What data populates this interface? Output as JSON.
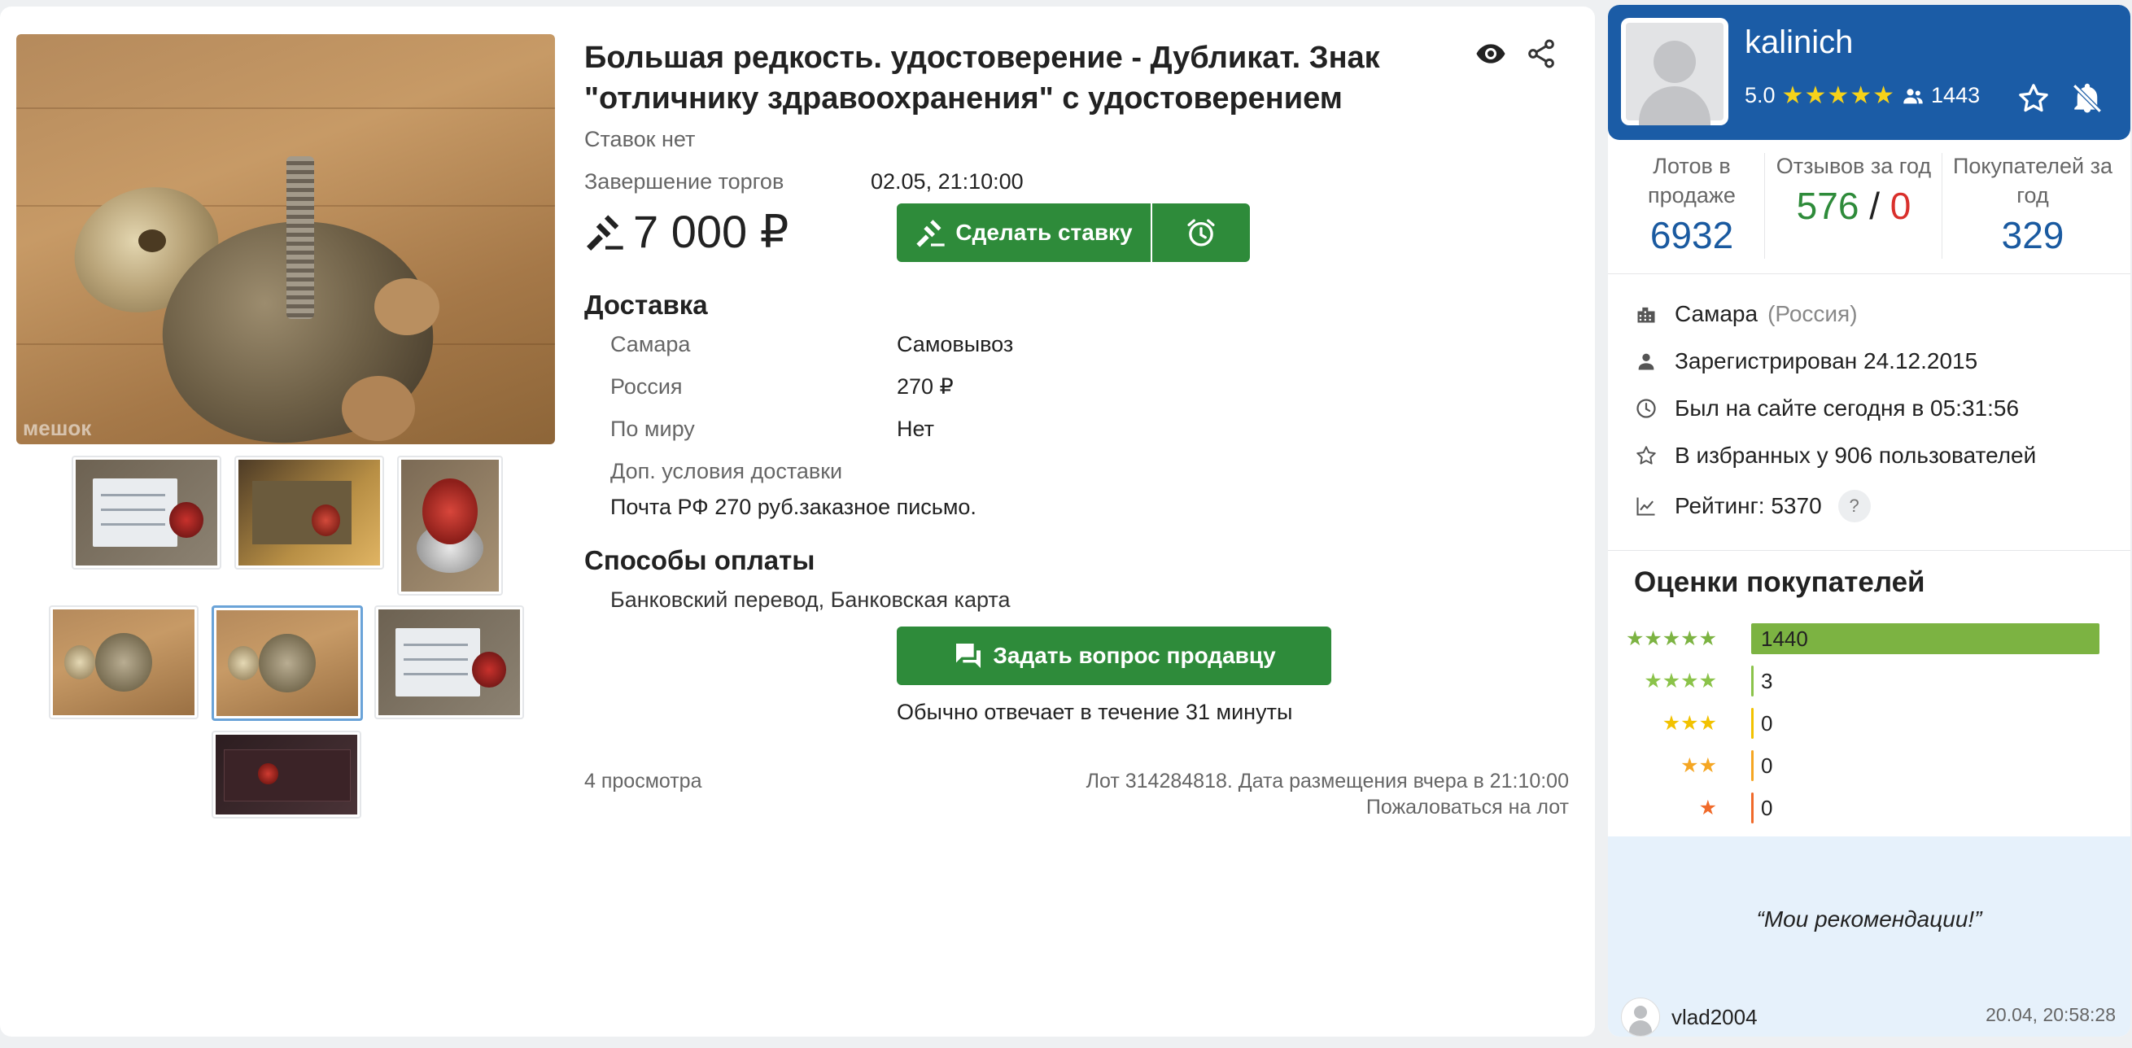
{
  "lot": {
    "title": "Большая редкость. удостоверение - Дубликат. Знак \"отличнику здравоохранения\" с удостоверением",
    "bids": "Ставок нет",
    "end_label": "Завершение торгов",
    "end_value": "02.05, 21:10:00",
    "price": "7 000 ₽",
    "bid_button": "Сделать ставку",
    "delivery_title": "Доставка",
    "delivery": [
      {
        "place": "Самара",
        "value": "Самовывоз"
      },
      {
        "place": "Россия",
        "value": "270 ₽"
      },
      {
        "place": "По миру",
        "value": "Нет"
      }
    ],
    "extra_label": "Доп. условия доставки",
    "extra_value": "Почта РФ 270 руб.заказное письмо.",
    "payment_title": "Способы оплаты",
    "payment_value": "Банковский перевод, Банковская карта",
    "ask_button": "Задать вопрос продавцу",
    "reply_note": "Обычно отвечает в течение 31 минуты",
    "views": "4 просмотра",
    "lot_info": "Лот 314284818. Дата размещения вчера в 21:10:00",
    "complain": "Пожаловаться на лот",
    "watermark": "мешок"
  },
  "seller": {
    "name": "kalinich",
    "rating": "5.0",
    "stars": "★★★★★",
    "followers": "1443",
    "stats": {
      "lots_label": "Лотов в продаже",
      "lots_value": "6932",
      "reviews_label": "Отзывов за год",
      "reviews_pos": "576",
      "reviews_sep": "/",
      "reviews_neg": "0",
      "buyers_label": "Покупателей за год",
      "buyers_value": "329"
    },
    "city": "Самара",
    "country": "(Россия)",
    "registered": "Зарегистрирован 24.12.2015",
    "last_seen": "Был на сайте сегодня в 05:31:56",
    "favorites": "В избранных у 906 пользователей",
    "rating_line": "Рейтинг: 5370",
    "help": "?"
  },
  "ratings": {
    "title": "Оценки покупателей",
    "rows": [
      {
        "stars": "★★★★★",
        "count": "1440",
        "fraction": 0.995
      },
      {
        "stars": "★★★★",
        "count": "3",
        "fraction": 0.002
      },
      {
        "stars": "★★★",
        "count": "0",
        "fraction": 0
      },
      {
        "stars": "★★",
        "count": "0",
        "fraction": 0
      },
      {
        "stars": "★",
        "count": "0",
        "fraction": 0
      }
    ],
    "colors": [
      "#7cb342",
      "#8bc34a",
      "#f2c200",
      "#f5a623",
      "#f06a2a"
    ]
  },
  "recommendation": {
    "quote": "“Мои рекомендации!”",
    "user": "vlad2004",
    "date": "20.04, 20:58:28"
  },
  "colors": {
    "green": "#2e8b3a",
    "blue_header": "#1b5ca6",
    "stat_blue": "#1a5aa0",
    "stat_green": "#2e8b3a",
    "stat_red": "#d9302c"
  }
}
